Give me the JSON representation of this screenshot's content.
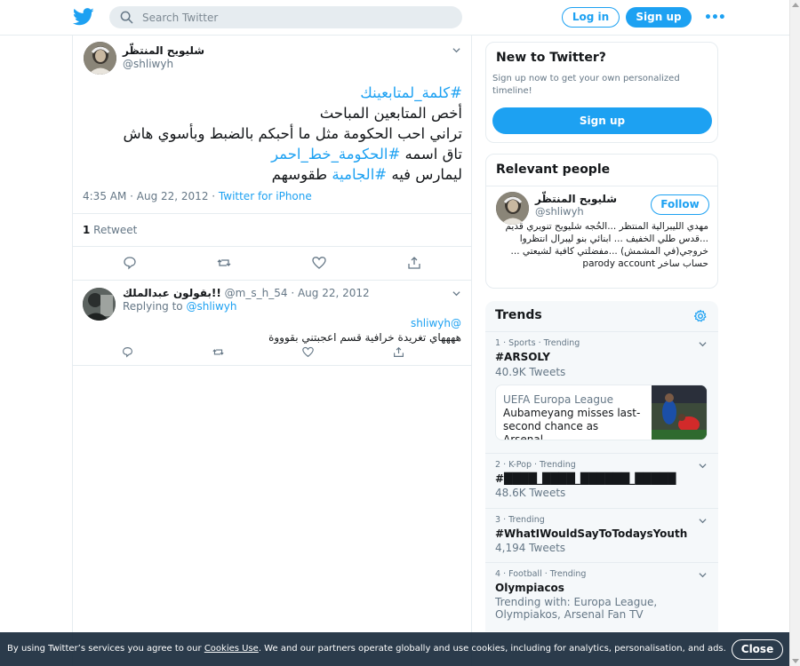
{
  "header": {
    "search_placeholder": "Search Twitter",
    "login_label": "Log in",
    "signup_label": "Sign up",
    "more_label": "•••"
  },
  "tweet": {
    "author_name": "شليويح المنتظّر",
    "author_handle": "@shliwyh",
    "body_lines": [
      {
        "parts": [
          {
            "t": "#كلمة_لمتابعينك",
            "link": true
          }
        ]
      },
      {
        "parts": [
          {
            "t": "أخص المتابعين المباحث",
            "link": false
          }
        ]
      },
      {
        "parts": [
          {
            "t": "تراني احب الحكومة مثل ما أحبكم بالضبط وبأسوي هاش",
            "link": false
          }
        ]
      },
      {
        "parts": [
          {
            "t": "تاق اسمه ",
            "link": false
          },
          {
            "t": "#الحكومة_خط_احمر",
            "link": true
          }
        ]
      },
      {
        "parts": [
          {
            "t": "ليمارس فيه ",
            "link": false
          },
          {
            "t": "#الجامية",
            "link": true
          },
          {
            "t": " طقوسهم",
            "link": false
          }
        ]
      }
    ],
    "time": "4:35 AM · Aug 22, 2012 · ",
    "source": "Twitter for iPhone",
    "retweet_count": "1",
    "retweet_label": " Retweet"
  },
  "reply": {
    "author_name": "بقولون عبدالملك!!",
    "author_handle": "@m_s_h_54",
    "date": " · Aug 22, 2012",
    "replying_prefix": "Replying to ",
    "replying_handle": "@shliwyh",
    "mention": "@shliwyh",
    "text": "ههههاي تغريدة خرافية قسم اعجبتني بقوووة"
  },
  "sidebar": {
    "new_title": "New to Twitter?",
    "new_desc": "Sign up now to get your own personalized timeline!",
    "new_signup": "Sign up",
    "relevant_title": "Relevant people",
    "person_name": "شليويح المنتظّر",
    "person_handle": "@shliwyh",
    "follow_label": "Follow",
    "person_bio": "مهدي الليبرالية المنتظر ...الحُجه شليويح تنويري قديم ...قدس طلي الخفيف ... ابنائي بنو ليبرال انتظروا خروجي(في المشمش) ...مفضلتي كافية لشيعتي ... حساب ساخر parody account",
    "trends_title": "Trends",
    "trends": [
      {
        "meta": "1 · Sports · Trending",
        "title": "#ARSOLY",
        "count": "40.9K Tweets",
        "news_source": "UEFA Europa League",
        "news_headline": "Aubameyang misses last-second chance as Arsenal..."
      },
      {
        "meta": "2 · K-Pop · Trending",
        "title": "#████_████_██████_█████",
        "count": "48.6K Tweets"
      },
      {
        "meta": "3 · Trending",
        "title": "#WhatIWouldSayToTodaysYouth",
        "count": "4,194 Tweets"
      },
      {
        "meta": "4 · Football · Trending",
        "title": "Olympiacos",
        "count": "Trending with: Europa League, Olympiakos, Arsenal Fan TV"
      }
    ]
  },
  "cookie": {
    "prefix": "By using Twitter’s services you agree to our ",
    "link": "Cookies Use",
    "suffix": ". We and our partners operate globally and use cookies, including for analytics, personalisation, and ads.",
    "close_label": "Close"
  },
  "colors": {
    "accent": "#1da1f2",
    "text": "#14171a",
    "muted": "#657786",
    "cookie_bg": "#1a2b3c"
  }
}
